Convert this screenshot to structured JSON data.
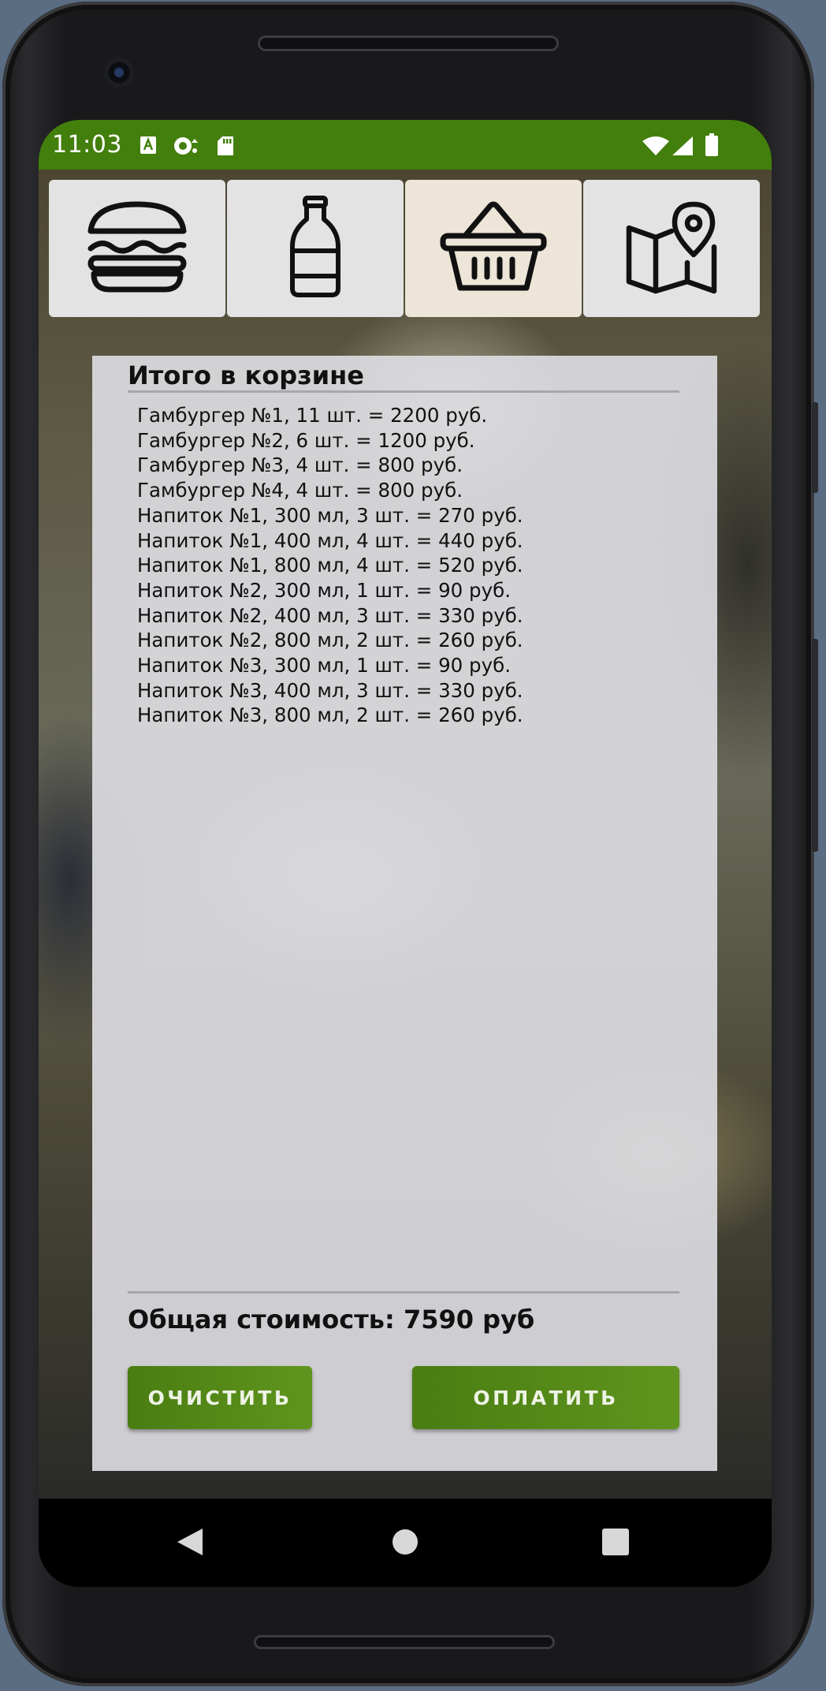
{
  "status_bar": {
    "time": "11:03",
    "left_icons": [
      "a-notification-icon",
      "sync-notification-icon",
      "sd-card-icon"
    ],
    "right_icons": [
      "wifi-icon",
      "cell-signal-icon",
      "battery-icon"
    ],
    "color": "#437f0c"
  },
  "tabs": [
    {
      "icon": "burger-icon",
      "active": false
    },
    {
      "icon": "bottle-icon",
      "active": false
    },
    {
      "icon": "basket-icon",
      "active": true
    },
    {
      "icon": "map-pin-icon",
      "active": false
    }
  ],
  "cart": {
    "title": "Итого в корзине",
    "items": [
      "Гамбургер №1, 11 шт. = 2200 руб.",
      "Гамбургер №2, 6 шт. = 1200 руб.",
      "Гамбургер №3, 4 шт. = 800 руб.",
      "Гамбургер №4, 4 шт. = 800 руб.",
      "Напиток №1, 300 мл, 3 шт. = 270 руб.",
      "Напиток №1, 400 мл, 4 шт. = 440 руб.",
      "Напиток №1, 800 мл, 4 шт. = 520 руб.",
      "Напиток №2, 300 мл, 1 шт. = 90 руб.",
      "Напиток №2, 400 мл, 3 шт. = 330 руб.",
      "Напиток №2, 800 мл, 2 шт. = 260 руб.",
      "Напиток №3, 300 мл, 1 шт. = 90 руб.",
      "Напиток №3, 400 мл, 3 шт. = 330 руб.",
      "Напиток №3, 800 мл, 2 шт. = 260 руб."
    ],
    "total": "Общая стоимость: 7590 руб",
    "clear_label": "ОЧИСТИТЬ",
    "pay_label": "ОПЛАТИТЬ",
    "button_color": "#4e8314"
  },
  "nav_bar": {
    "icons": [
      "back-icon",
      "home-icon",
      "recents-icon"
    ]
  }
}
